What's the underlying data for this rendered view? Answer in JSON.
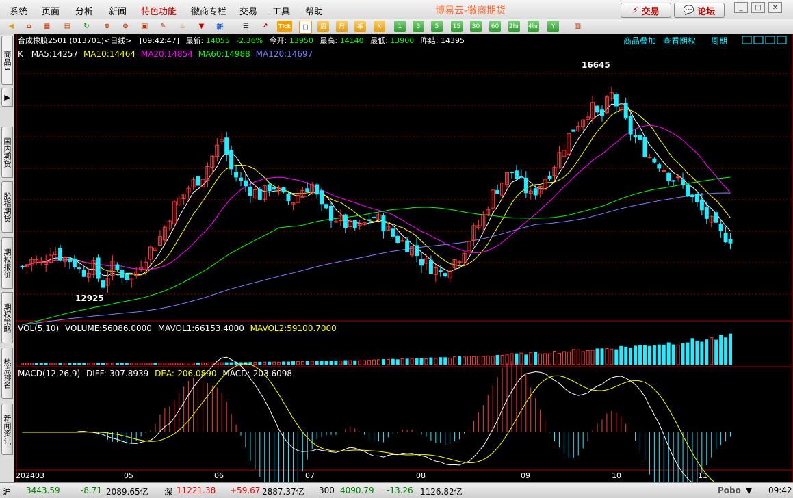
{
  "menu": [
    "系统",
    "页面",
    "分析",
    "新闻",
    "特色功能",
    "徽商专栏",
    "交易",
    "工具",
    "帮助"
  ],
  "brand": "博易云-徽商期货",
  "buttons": {
    "trade": "交易",
    "forum": "论坛"
  },
  "toolbar": {
    "periods": [
      "日",
      "周",
      "月",
      "季",
      "X",
      "1",
      "3",
      "5",
      "15",
      "30",
      "60",
      "2hr",
      "4hr",
      "Y"
    ],
    "selected": "日",
    "tick_label": "Tick"
  },
  "sidebar_tabs": [
    "商品3",
    "国内期货",
    "股指期货",
    "期权报价",
    "期权策略",
    "热点排名",
    "新闻资讯"
  ],
  "header": {
    "symbol": "合成橡胶2501 (013701)<日线>",
    "time": "[09:42:47]",
    "latest_label": "最新:",
    "latest": "14055",
    "change": "-2.36%",
    "open_label": "今开:",
    "open": "13950",
    "high_label": "最高:",
    "high": "14140",
    "low_label": "最低:",
    "low": "13900",
    "prev_label": "昨结:",
    "prev": "14395",
    "links": [
      "商品叠加",
      "查看期权",
      "周期"
    ]
  },
  "ma_legend": {
    "k": "K",
    "ma5": "MA5:14257",
    "ma10": "MA10:14464",
    "ma20": "MA20:14854",
    "ma60": "MA60:14988",
    "ma120": "MA120:14697"
  },
  "vol_legend": {
    "title": "VOL(5,10)",
    "volume": "VOLUME:56086.0000",
    "mavol1": "MAVOL1:66153.4000",
    "mavol2": "MAVOL2:59100.7000"
  },
  "macd_legend": {
    "title": "MACD(12,26,9)",
    "diff": "DIFF:-307.8939",
    "dea": "DEA:-206.0890",
    "macd": "MACD:-203.6098"
  },
  "annotations": {
    "high": "16645",
    "low": "12925"
  },
  "xaxis": [
    "202403",
    "05",
    "06",
    "07",
    "08",
    "09",
    "10",
    "11"
  ],
  "status": {
    "sh_label": "沪",
    "sh": "3443.59",
    "sh_chg": "-8.71",
    "sh_amt": "2089.65亿",
    "sz_label": "深",
    "sz": "11221.38",
    "sz_chg": "+59.67",
    "sz_amt": "2887.37亿",
    "i300_label": "300",
    "i300": "4090.79",
    "i300_chg": "-13.26",
    "i300_amt": "1126.82亿",
    "brand": "Pobo",
    "clock": "09:42"
  },
  "colors": {
    "up": "#ff3b3b",
    "down": "#27e9ff",
    "ma5": "#ffffff",
    "ma10": "#ffff00",
    "ma20": "#ff00ff",
    "ma60": "#00ff00",
    "ma120": "#8080ff",
    "grid": "#8b0000"
  },
  "chart_data": {
    "type": "candlestick",
    "price_range": [
      12800,
      16800
    ],
    "high_marker": 16645,
    "low_marker": 12925,
    "close_path": [
      13600,
      13700,
      13650,
      13900,
      13750,
      13700,
      13500,
      13650,
      13300,
      13600,
      13500,
      13400,
      13700,
      13900,
      14100,
      14500,
      14700,
      14900,
      15000,
      15300,
      15600,
      15100,
      14900,
      14800,
      14700,
      14900,
      14700,
      14600,
      14800,
      14900,
      14500,
      14400,
      14300,
      14200,
      14200,
      14400,
      14300,
      14100,
      14000,
      13900,
      13700,
      13600,
      13500,
      13650,
      13800,
      14100,
      14300,
      14700,
      14900,
      15100,
      14900,
      14700,
      14900,
      15100,
      15400,
      15700,
      15900,
      16100,
      15900,
      16300,
      16000,
      15700,
      15500,
      15300,
      15200,
      15000,
      14900,
      14700,
      14500,
      14300,
      14100,
      14055
    ],
    "macd_range": [
      -600,
      600
    ]
  }
}
